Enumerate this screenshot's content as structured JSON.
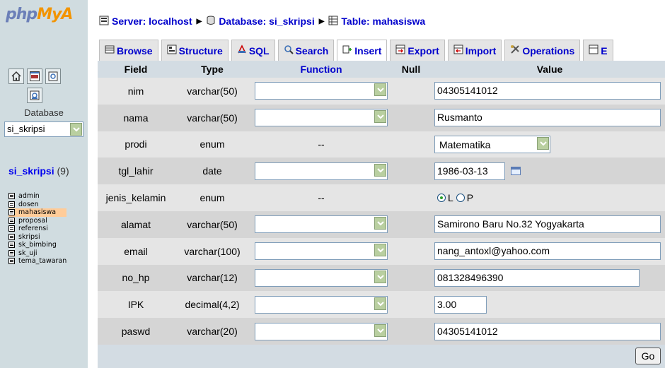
{
  "logo": {
    "part1": "php",
    "part2": "MyA"
  },
  "sidebar": {
    "database_label": "Database",
    "database_value": "si_skripsi",
    "db_title": "si_skripsi",
    "db_count": "(9)",
    "tables": [
      "admin",
      "dosen",
      "mahasiswa",
      "proposal",
      "referensi",
      "skripsi",
      "sk_bimbing",
      "sk_uji",
      "tema_tawaran"
    ],
    "active_table": "mahasiswa"
  },
  "breadcrumb": {
    "server": "Server: localhost",
    "database": "Database: si_skripsi",
    "table": "Table: mahasiswa"
  },
  "tabs": [
    "Browse",
    "Structure",
    "SQL",
    "Search",
    "Insert",
    "Export",
    "Import",
    "Operations",
    "E"
  ],
  "active_tab": "Insert",
  "form": {
    "headers": {
      "field": "Field",
      "type": "Type",
      "function": "Function",
      "null": "Null",
      "value": "Value"
    },
    "rows": [
      {
        "field": "nim",
        "type": "varchar(50)",
        "kind": "text",
        "value": "04305141012"
      },
      {
        "field": "nama",
        "type": "varchar(50)",
        "kind": "text",
        "value": "Rusmanto"
      },
      {
        "field": "prodi",
        "type": "enum",
        "kind": "enum-select",
        "function_text": "--",
        "value": "Matematika"
      },
      {
        "field": "tgl_lahir",
        "type": "date",
        "kind": "date",
        "value": "1986-03-13"
      },
      {
        "field": "jenis_kelamin",
        "type": "enum",
        "kind": "radio",
        "function_text": "--",
        "options": [
          "L",
          "P"
        ],
        "selected": "L"
      },
      {
        "field": "alamat",
        "type": "varchar(50)",
        "kind": "text",
        "value": "Samirono Baru No.32 Yogyakarta"
      },
      {
        "field": "email",
        "type": "varchar(100)",
        "kind": "text",
        "value": "nang_antoxl@yahoo.com"
      },
      {
        "field": "no_hp",
        "type": "varchar(12)",
        "kind": "text",
        "value": "081328496390"
      },
      {
        "field": "IPK",
        "type": "decimal(4,2)",
        "kind": "text",
        "value": "3.00"
      },
      {
        "field": "paswd",
        "type": "varchar(20)",
        "kind": "text",
        "value": "04305141012"
      }
    ]
  },
  "go_label": "Go"
}
